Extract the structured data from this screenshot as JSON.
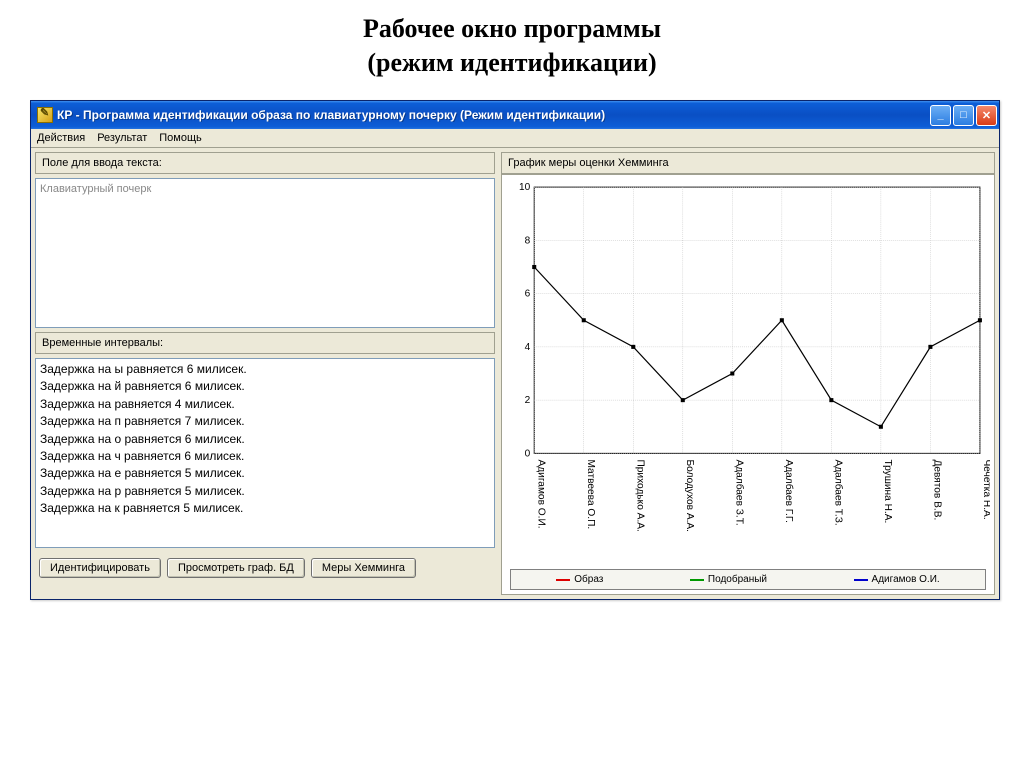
{
  "page_heading_line1": "Рабочее окно программы",
  "page_heading_line2": "(режим идентификации)",
  "window": {
    "title": "КР - Программа идентификации образа по клавиатурному почерку (Режим идентификации)"
  },
  "menu": {
    "actions": "Действия",
    "result": "Результат",
    "help": "Помощь"
  },
  "left": {
    "input_label": "Поле для ввода текста:",
    "placeholder": "Клавиатурный почерк",
    "intervals_label": "Временные интервалы:",
    "intervals": [
      "Задержка на ы равняется 6 милисек.",
      "Задержка на й равняется 6 милисек.",
      "Задержка на   равняется 4 милисек.",
      "Задержка на п равняется 7 милисек.",
      "Задержка на о равняется 6 милисек.",
      "Задержка на ч равняется 6 милисек.",
      "Задержка на е равняется 5 милисек.",
      "Задержка на р равняется 5 милисек.",
      "Задержка на к равняется 5 милисек."
    ]
  },
  "buttons": {
    "identify": "Идентифицировать",
    "view_graph": "Просмотреть граф. БД",
    "hamming": "Меры Хемминга"
  },
  "chart_label": "График меры оценки Хемминга",
  "legend": {
    "image": "Образ",
    "selected": "Подобраный",
    "person": "Адигамов О.И."
  },
  "chart_data": {
    "type": "line",
    "title": "График меры оценки Хемминга",
    "xlabel": "",
    "ylabel": "",
    "ylim": [
      0,
      10
    ],
    "yticks": [
      0,
      2,
      4,
      6,
      8,
      10
    ],
    "categories": [
      "Адигамов О.И.",
      "Матвеева О.П.",
      "Приходько А.А.",
      "Болодухов А.А.",
      "Адалбаев З.Т.",
      "Адалбаев Г.Г.",
      "Адалбаев Т.З.",
      "Трушина Н.А.",
      "Девятов В.В.",
      "Чечетка Н.А."
    ],
    "series": [
      {
        "name": "Адигамов О.И.",
        "values": [
          7,
          5,
          4,
          2,
          3,
          5,
          2,
          1,
          4,
          5
        ]
      }
    ]
  }
}
